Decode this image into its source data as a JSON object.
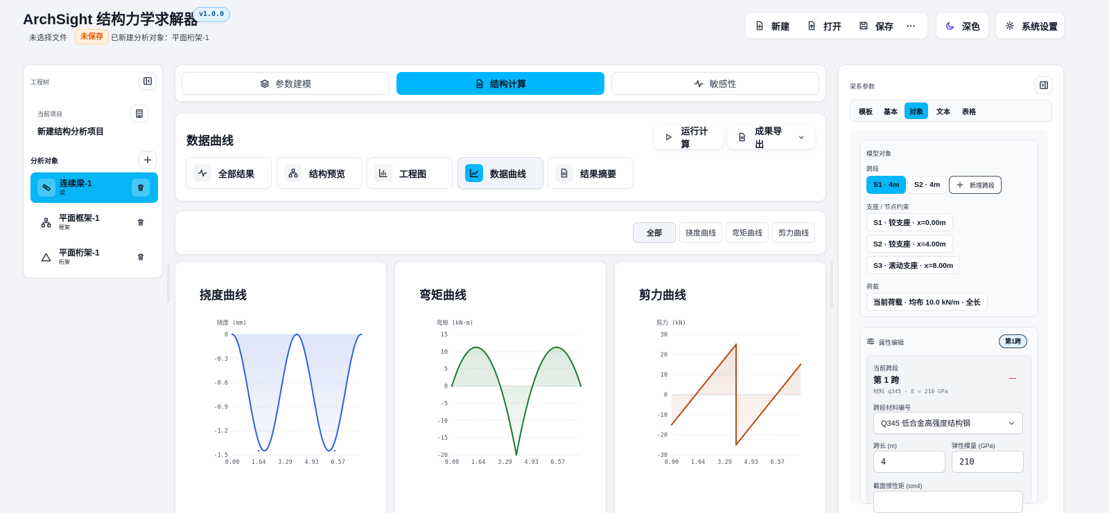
{
  "header": {
    "app_title": "ArchSight 结构力学求解器",
    "version": "v1.0.0",
    "file_status": "未选择文件",
    "save_status": "未保存",
    "created_object": "已新建分析对象：平面桁架-1",
    "buttons": {
      "new": "新建",
      "open": "打开",
      "save": "保存",
      "more": "···",
      "theme": "深色",
      "settings": "系统设置"
    }
  },
  "left_panel": {
    "title": "工程树",
    "current_project_label": "当前项目",
    "project_name": "新建结构分析项目",
    "objects_label": "分析对象",
    "objects": [
      {
        "name": "连续梁-1",
        "type": "梁",
        "active": true
      },
      {
        "name": "平面框架-1",
        "type": "框架",
        "active": false
      },
      {
        "name": "平面桁架-1",
        "type": "桁架",
        "active": false
      }
    ]
  },
  "main_tabs": [
    "参数建模",
    "结构计算",
    "敏感性"
  ],
  "results": {
    "title": "数据曲线",
    "run_button": "运行计算",
    "export_button": "成果导出",
    "views": [
      "全部结果",
      "结构预览",
      "工程图",
      "数据曲线",
      "结果摘要"
    ],
    "filters": [
      "全部",
      "挠度曲线",
      "弯矩曲线",
      "剪力曲线"
    ]
  },
  "chart_data": [
    {
      "type": "line",
      "title": "挠度曲线",
      "ylabel": "挠度 (mm)",
      "xlim": [
        0,
        8
      ],
      "ylim": [
        -1.5,
        0
      ],
      "xticks": [
        "0.00",
        "1.64",
        "3.29",
        "4.93",
        "6.57"
      ],
      "yticks": [
        "0",
        "-0.3",
        "-0.6",
        "-0.9",
        "-1.2",
        "-1.5"
      ],
      "x": [
        0,
        1.64,
        4,
        6.36,
        8
      ],
      "y": [
        0,
        -1.45,
        0,
        -1.45,
        0
      ],
      "color": "#2f5ee0"
    },
    {
      "type": "line",
      "title": "弯矩曲线",
      "ylabel": "弯矩 (kN·m)",
      "xlim": [
        0,
        8
      ],
      "ylim": [
        -20,
        15
      ],
      "xticks": [
        "0.00",
        "1.64",
        "3.29",
        "4.93",
        "6.57"
      ],
      "yticks": [
        "15",
        "10",
        "5",
        "0",
        "-5",
        "-10",
        "-15",
        "-20"
      ],
      "x": [
        0,
        1.5,
        4,
        6.5,
        8
      ],
      "y": [
        0,
        11.25,
        -20,
        11.25,
        0
      ],
      "color": "#1b7a35"
    },
    {
      "type": "line",
      "title": "剪力曲线",
      "ylabel": "剪力 (kN)",
      "xlim": [
        0,
        8
      ],
      "ylim": [
        -30,
        30
      ],
      "xticks": [
        "0.00",
        "1.64",
        "3.29",
        "4.93",
        "6.57"
      ],
      "yticks": [
        "30",
        "20",
        "10",
        "0",
        "-10",
        "-20",
        "-30"
      ],
      "x": [
        0,
        4,
        4,
        8
      ],
      "y": [
        -15,
        25,
        -25,
        15
      ],
      "color": "#b84a12"
    }
  ],
  "right_panel": {
    "title": "梁系参数",
    "tabs": [
      "模板",
      "基本",
      "对象",
      "文本",
      "表格"
    ],
    "active_tab": "对象",
    "model_objects_label": "模型对象",
    "span_label": "跨段",
    "spans": [
      "S1 · 4m",
      "S2 · 4m"
    ],
    "add_span": "新增跨段",
    "supports_label": "支座 / 节点约束",
    "supports": [
      "S1 · 铰支座 · x=0.00m",
      "S2 · 铰支座 · x=4.00m",
      "S3 · 滚动支座 · x=8.00m"
    ],
    "load_label": "荷载",
    "load": "当前荷载 · 均布 10.0 kN/m · 全长",
    "property_label": "属性编辑",
    "property_badge": "第1跨",
    "current_span_label": "当前跨段",
    "current_span": "第 1 跨",
    "material_info": "材料 q345 · E = 210 GPa",
    "material_id_label": "跨段材料编号",
    "material_select": "Q345 低合金高强度结构钢",
    "length_label": "跨长 (m)",
    "length_value": "4",
    "modulus_label": "弹性模量 (GPa)",
    "modulus_value": "210",
    "inertia_label": "截面惯性矩 (cm4)"
  },
  "colors": {
    "accent": "#06b6f6",
    "warning": "#ea580c"
  }
}
